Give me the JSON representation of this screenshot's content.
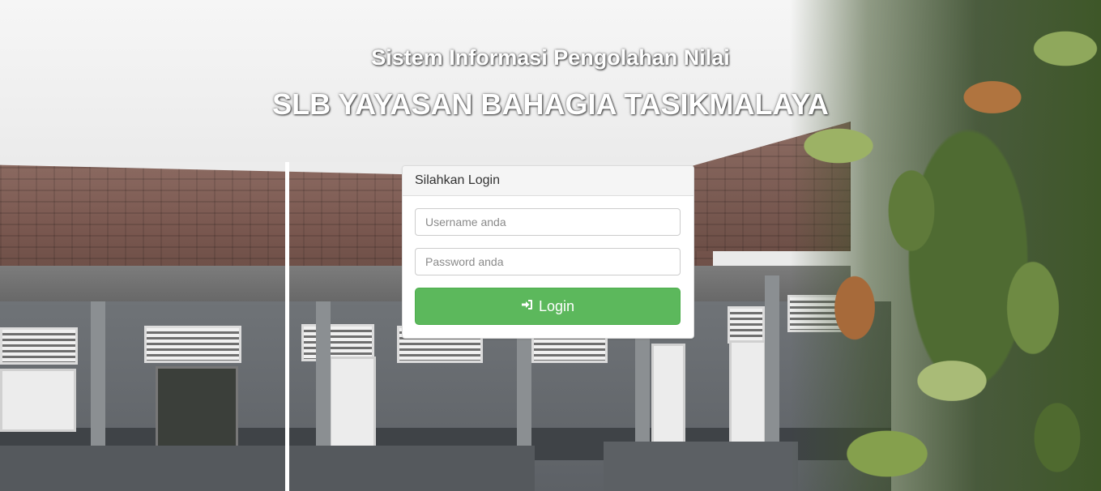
{
  "header": {
    "subtitle": "Sistem Informasi Pengolahan Nilai",
    "title": "SLB YAYASAN BAHAGIA TASIKMALAYA"
  },
  "login_panel": {
    "heading": "Silahkan Login",
    "username": {
      "value": "",
      "placeholder": "Username anda"
    },
    "password": {
      "value": "",
      "placeholder": "Password anda"
    },
    "submit": {
      "label": "Login",
      "icon": "sign-in-icon"
    }
  },
  "colors": {
    "button_green": "#5cb85c",
    "panel_heading_bg": "#f5f5f5"
  }
}
